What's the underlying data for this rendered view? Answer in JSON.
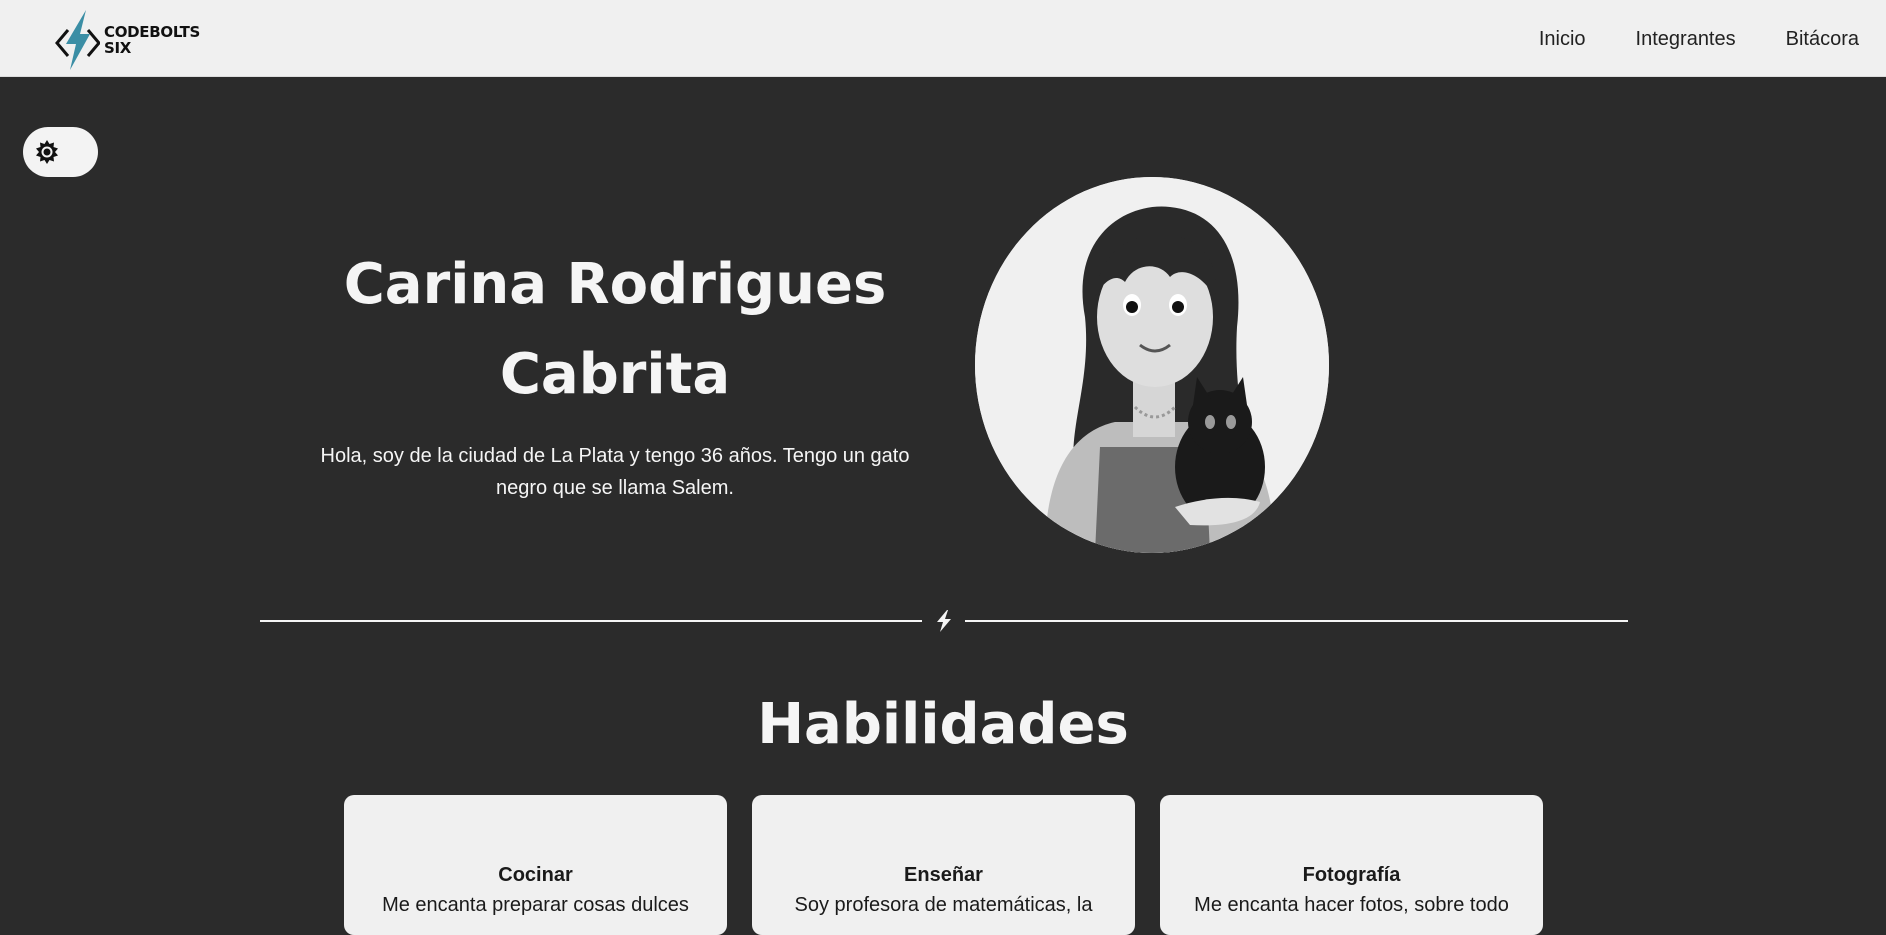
{
  "brand": {
    "line1": "CODEBOLTS",
    "line2": "SIX",
    "accent_color": "#3b8ea5"
  },
  "nav": {
    "items": [
      {
        "label": "Inicio"
      },
      {
        "label": "Integrantes"
      },
      {
        "label": "Bitácora"
      }
    ]
  },
  "theme_toggle": {
    "icon": "sun-icon"
  },
  "hero": {
    "name_line1": "Carina Rodrigues",
    "name_line2": "Cabrita",
    "bio": "Hola, soy de la ciudad de La Plata y tengo 36 años. Tengo un gato negro que se llama Salem."
  },
  "divider": {
    "icon": "bolt-icon"
  },
  "skills": {
    "title": "Habilidades",
    "cards": [
      {
        "title": "Cocinar",
        "desc": "Me encanta preparar cosas dulces"
      },
      {
        "title": "Enseñar",
        "desc": "Soy profesora de matemáticas, la"
      },
      {
        "title": "Fotografía",
        "desc": "Me encanta hacer fotos, sobre todo"
      }
    ]
  },
  "colors": {
    "page_bg": "#2b2b2b",
    "navbar_bg": "#f0f0f0",
    "card_bg": "#f0f0f0",
    "text_light": "#f5f5f5"
  }
}
